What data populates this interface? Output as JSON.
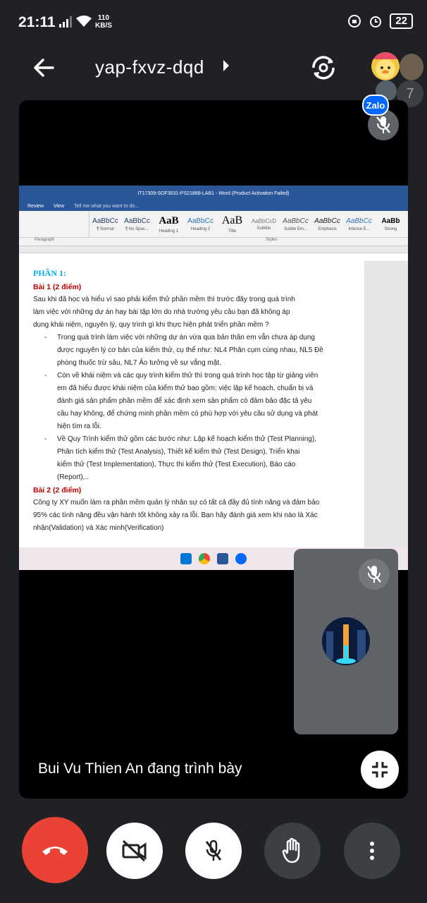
{
  "status_bar": {
    "time": "21:11",
    "net_speed_value": "110",
    "net_speed_unit": "KB/S",
    "battery": "22"
  },
  "meeting": {
    "code": "yap-fxvz-dqd",
    "participant_overflow": "7",
    "presenter_text": "Bui Vu Thien An đang trình bày"
  },
  "overlay_badge": "Zalo",
  "shared_screen": {
    "window_title": "IT17309-SOF3031-PS21888-LAB1 - Word (Product Activation Failed)",
    "tabs": [
      "Review",
      "View",
      "Tell me what you want to do..."
    ],
    "styles": [
      {
        "sample": "AaBbCc",
        "name": "¶ Normal"
      },
      {
        "sample": "AaBbCc",
        "name": "¶ No Spac..."
      },
      {
        "sample": "AaB",
        "name": "Heading 1"
      },
      {
        "sample": "AaBbCc",
        "name": "Heading 2"
      },
      {
        "sample": "AaB",
        "name": "Title"
      },
      {
        "sample": "AaBbCcD",
        "name": "Subtitle"
      },
      {
        "sample": "AaBbCc",
        "name": "Subtle Em..."
      },
      {
        "sample": "AaBbCc",
        "name": "Emphasis"
      },
      {
        "sample": "AaBbCc",
        "name": "Intense E..."
      },
      {
        "sample": "AaBb",
        "name": "Strong"
      }
    ],
    "group_paragraph": "Paragraph",
    "group_styles": "Styles",
    "doc": {
      "part": "PHẦN 1:",
      "bai1": "Bài 1 (2 điểm)",
      "q1_lines": [
        "Sau khi đã học và hiểu vì sao phải kiểm thử phần mềm thì trước đây trong quá trình",
        "làm việc với những dự án hay bài tập lớn do nhà trường yêu cầu bạn đã không áp",
        "dụng khái niệm, nguyên lý, quy trình gì khi thực hiện phát triển phần mềm ?"
      ],
      "bullets": [
        [
          "Trong quá trình làm việc với những dự án vừa qua bản thân em vẫn chưa áp dụng",
          "được nguyên lý cơ bản của kiểm thử, cụ thể như: NL4 Phân cụm cùng nhau, NL5 Đề",
          "phòng thuốc trừ sâu, NL7 Ảo tưởng về sự vắng mặt."
        ],
        [
          "Còn về khái niệm và các quy trình kiểm thử thì trong quá trình học tập từ giảng viên",
          "em đã hiểu được khái niệm của kiểm thử bao gồm: việc lập kế hoạch, chuẩn bị và",
          "đánh giá sản phẩm phần mềm để xác định xem sản phẩm có đảm bảo đặc tả yêu",
          "cầu hay không, để chứng minh phần mềm có phù hợp với yêu cầu sử dụng và phát",
          "hiện tìm ra lỗi."
        ],
        [
          "Về Quy Trình kiểm thử gồm các bước như: Lập kế hoạch kiểm thử (Test Planning),",
          "Phân tích  kiểm thử (Test Analysis), Thiết kế kiểm thử (Test Design),  Triển khai",
          "kiểm thử (Test Implementation), Thực thi kiểm thử (Test Execution), Báo cáo",
          "(Report),.."
        ]
      ],
      "bai2": "Bài 2 (2 điểm)",
      "q2_lines": [
        "Công ty XY muốn làm ra phần mềm quản lý nhân sự có tất cả đầy đủ tính năng và đảm bảo",
        "95% các tính năng đều vận hành tốt không xảy ra lỗi. Bạn hãy đánh giá xem khi nào là Xác",
        "nhận(Validation) và Xác minh(Verification)"
      ]
    }
  },
  "colors": {
    "background": "#202124",
    "end_call": "#ea4335",
    "word_blue": "#2b579a",
    "heading_cyan": "#00b0f0",
    "heading_red": "#c00000"
  },
  "icons": [
    "back-arrow-icon",
    "caret-right-icon",
    "switch-camera-icon",
    "mic-off-icon",
    "fullscreen-exit-icon",
    "end-call-icon",
    "camera-off-icon",
    "raise-hand-icon",
    "more-vert-icon"
  ]
}
